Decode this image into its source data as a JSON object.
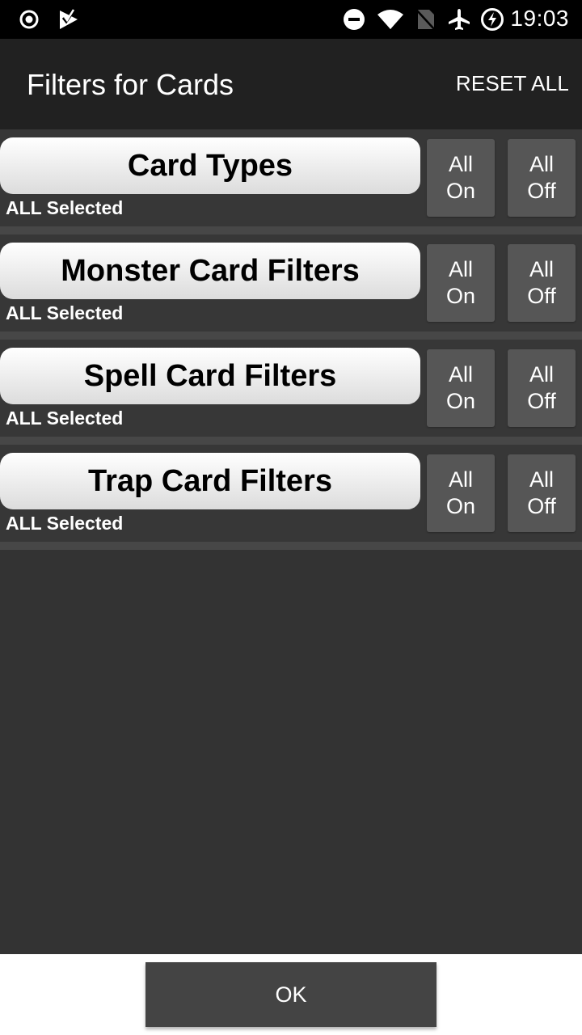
{
  "status_bar": {
    "time": "19:03",
    "left_icons": [
      "record-icon",
      "play-store-check-icon"
    ],
    "right_icons": [
      "do-not-disturb-icon",
      "wifi-icon",
      "no-sim-icon",
      "airplane-mode-icon",
      "battery-saver-icon"
    ]
  },
  "app_bar": {
    "title": "Filters for Cards",
    "reset_all_label": "RESET ALL"
  },
  "filters": [
    {
      "title": "Card Types",
      "status": "ALL Selected",
      "all_on": [
        "All",
        "On"
      ],
      "all_off": [
        "All",
        "Off"
      ]
    },
    {
      "title": "Monster Card Filters",
      "status": "ALL Selected",
      "all_on": [
        "All",
        "On"
      ],
      "all_off": [
        "All",
        "Off"
      ]
    },
    {
      "title": "Spell Card Filters",
      "status": "ALL Selected",
      "all_on": [
        "All",
        "On"
      ],
      "all_off": [
        "All",
        "Off"
      ]
    },
    {
      "title": "Trap Card Filters",
      "status": "ALL Selected",
      "all_on": [
        "All",
        "On"
      ],
      "all_off": [
        "All",
        "Off"
      ]
    }
  ],
  "footer": {
    "ok_label": "OK"
  }
}
